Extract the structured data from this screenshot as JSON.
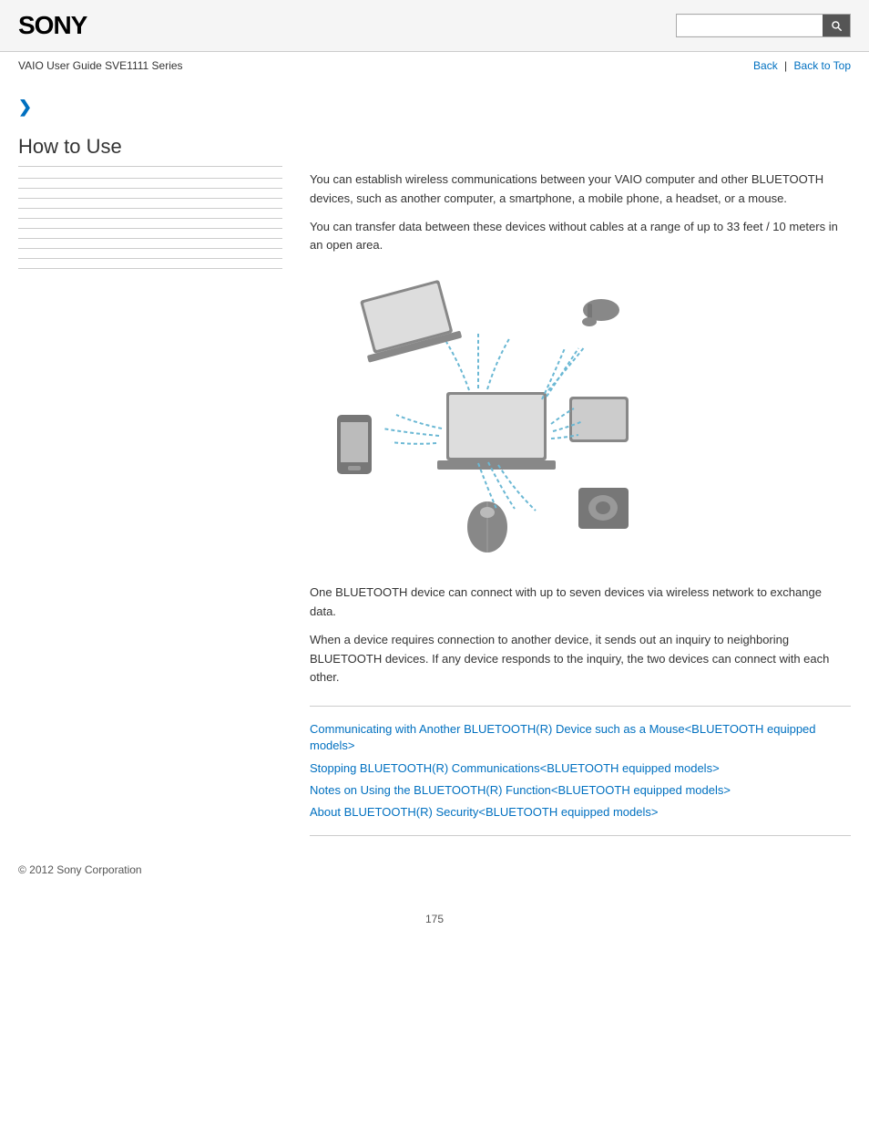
{
  "header": {
    "logo": "SONY",
    "search_placeholder": ""
  },
  "subheader": {
    "guide_title": "VAIO User Guide SVE1111 Series",
    "back_label": "Back",
    "back_to_top_label": "Back to Top"
  },
  "sidebar": {
    "chevron": "❯",
    "section_title": "How to Use",
    "lines": 10
  },
  "content": {
    "para1": "You can establish wireless communications between your VAIO computer and other BLUETOOTH devices, such as another computer, a smartphone, a mobile phone, a headset, or a mouse.",
    "para2": "You can transfer data between these devices without cables at a range of up to 33 feet / 10 meters in an open area.",
    "para3": "One BLUETOOTH device can connect with up to seven devices via wireless network to exchange data.",
    "para4": "When a device requires connection to another device, it sends out an inquiry to neighboring BLUETOOTH devices. If any device responds to the inquiry, the two devices can connect with each other."
  },
  "related_links": {
    "link1": "Communicating with Another BLUETOOTH(R) Device such as a Mouse<BLUETOOTH equipped models>",
    "link2": "Stopping BLUETOOTH(R) Communications<BLUETOOTH equipped models>",
    "link3": "Notes on Using the BLUETOOTH(R) Function<BLUETOOTH equipped models>",
    "link4": "About BLUETOOTH(R) Security<BLUETOOTH equipped models>"
  },
  "footer": {
    "copyright": "© 2012 Sony Corporation"
  },
  "page": {
    "number": "175"
  }
}
